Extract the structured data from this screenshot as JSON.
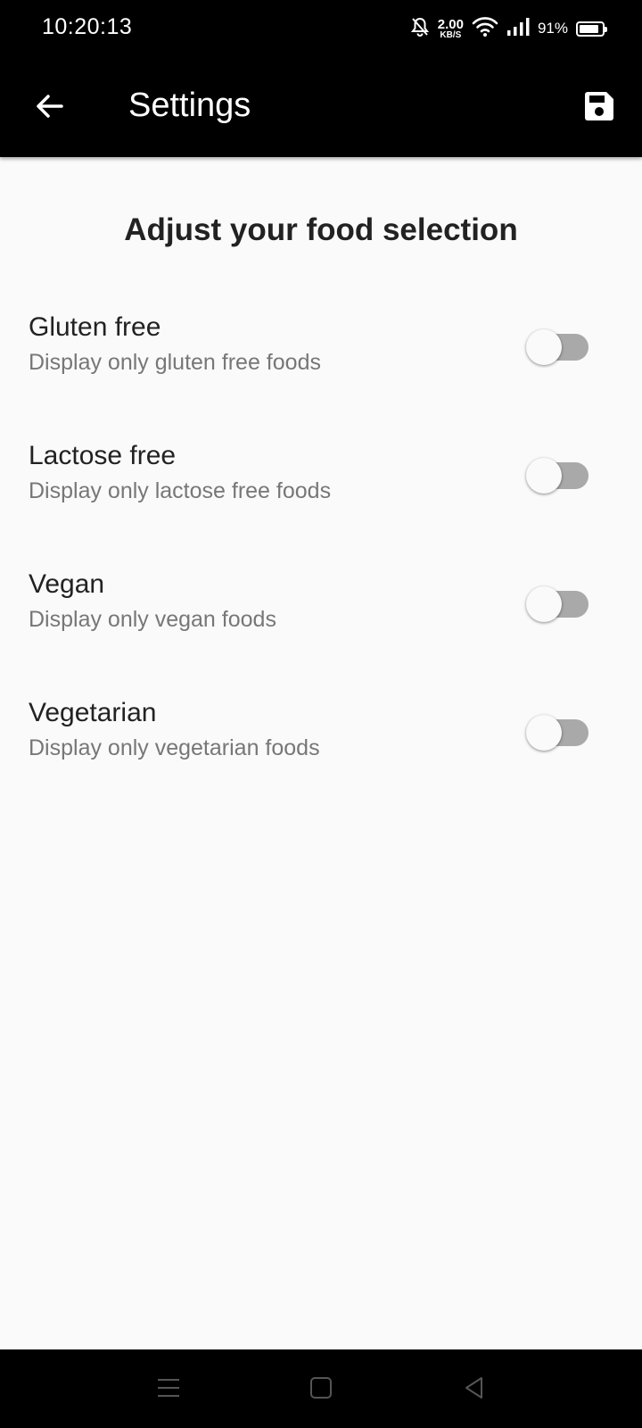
{
  "status_bar": {
    "time": "10:20:13",
    "net_speed_value": "2.00",
    "net_speed_unit": "KB/S",
    "battery_percent": "91%",
    "battery_level": 0.91,
    "icons": [
      "bell-off-icon",
      "wifi-icon",
      "signal-icon",
      "battery-icon"
    ]
  },
  "app_bar": {
    "title": "Settings",
    "back_icon": "arrow-left-icon",
    "save_icon": "save-icon"
  },
  "heading": "Adjust your food selection",
  "settings": [
    {
      "title": "Gluten free",
      "subtitle": "Display only gluten free foods",
      "enabled": false
    },
    {
      "title": "Lactose free",
      "subtitle": "Display only lactose free foods",
      "enabled": false
    },
    {
      "title": "Vegan",
      "subtitle": "Display only vegan foods",
      "enabled": false
    },
    {
      "title": "Vegetarian",
      "subtitle": "Display only vegetarian foods",
      "enabled": false
    }
  ],
  "nav_bar": {
    "icons": [
      "menu-icon",
      "home-square-icon",
      "back-triangle-icon"
    ]
  },
  "colors": {
    "app_bar_bg": "#000000",
    "page_bg": "#fafafa",
    "toggle_track_off": "#a9a9a9",
    "subtitle_text": "#777777"
  }
}
